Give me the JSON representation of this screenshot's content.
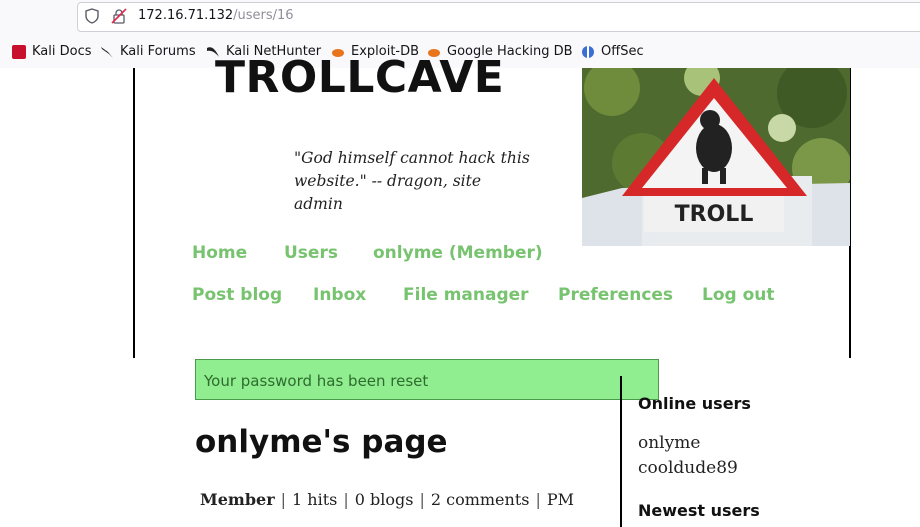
{
  "browser": {
    "url_host": "172.16.71.132",
    "url_path": "/users/16",
    "bookmarks": [
      "Kali Docs",
      "Kali Forums",
      "Kali NetHunter",
      "Exploit-DB",
      "Google Hacking DB",
      "OffSec"
    ]
  },
  "site": {
    "title": "TROLLCAVE",
    "tagline": "\"God himself cannot hack this website.\" -- dragon, site admin",
    "sign_text": "TROLL"
  },
  "nav": {
    "row1": [
      "Home",
      "Users",
      "onlyme (Member)"
    ],
    "row2": [
      "Post blog",
      "Inbox",
      "File manager",
      "Preferences",
      "Log out"
    ]
  },
  "alert": {
    "message": "Your password has been reset"
  },
  "profile": {
    "title": "onlyme's page",
    "role": "Member",
    "hits": "1 hits",
    "blogs": "0 blogs",
    "comments": "2 comments",
    "pm": "PM"
  },
  "sidebar": {
    "online_heading": "Online users",
    "online_users": [
      "onlyme",
      "cooldude89"
    ],
    "newest_heading": "Newest users"
  },
  "colors": {
    "nav_link": "#77c36f",
    "alert_bg": "#90ee90"
  }
}
